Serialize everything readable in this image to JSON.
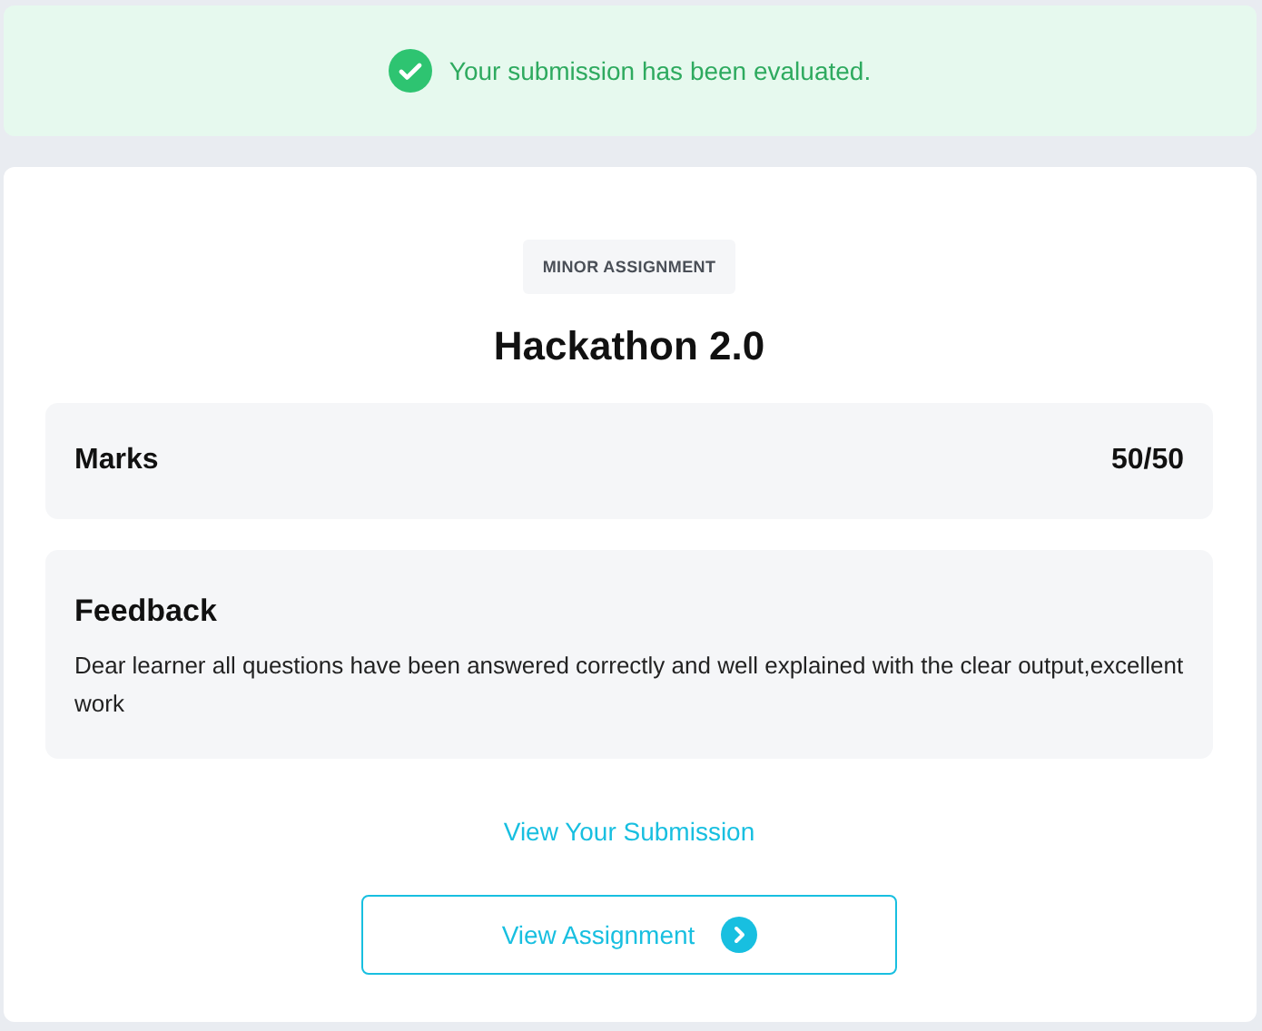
{
  "banner": {
    "message": "Your submission has been evaluated."
  },
  "assignment": {
    "tag": "MINOR ASSIGNMENT",
    "title": "Hackathon 2.0"
  },
  "marks": {
    "label": "Marks",
    "value": "50/50"
  },
  "feedback": {
    "heading": "Feedback",
    "text": "Dear learner all questions have been answered correctly and well explained with the clear output,excellent work"
  },
  "links": {
    "submission": "View Your Submission",
    "assignment_button": "View Assignment"
  }
}
